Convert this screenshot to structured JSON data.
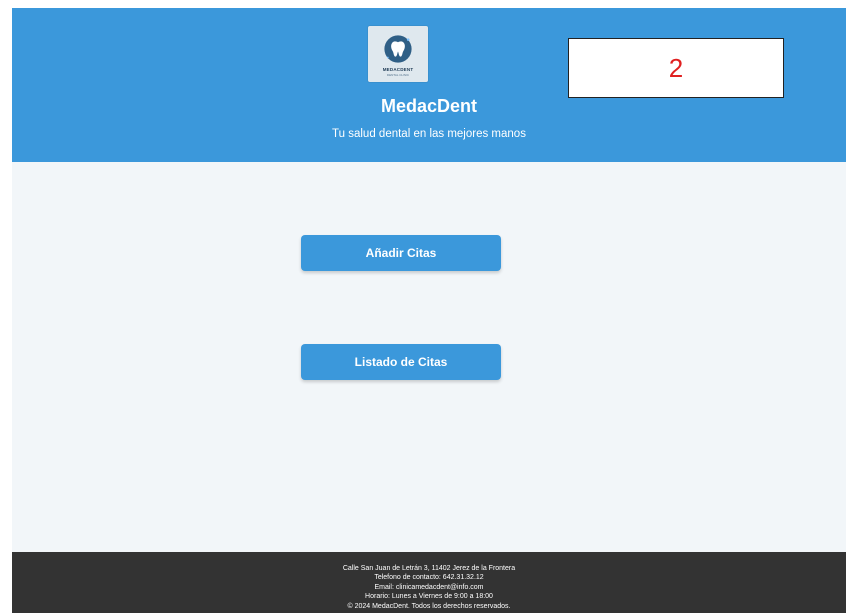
{
  "header": {
    "logo": {
      "icon": "tooth-icon",
      "text": "MEDACDENT",
      "subtext": "DENTAL CLINIC"
    },
    "title": "MedacDent",
    "tagline": "Tu salud dental en las mejores manos",
    "counter_box": "2"
  },
  "main": {
    "add_button_label": "Añadir Citas",
    "list_button_label": "Listado de Citas"
  },
  "footer": {
    "address": "Calle San Juan de Letrán 3, 11402 Jerez de la Frontera",
    "phone": "Telefono de contacto: 642.31.32.12",
    "email": "Email: clinicamedacdent@info.com",
    "hours": "Horario: Lunes a Viernes de 9:00 a 18:00",
    "copyright": "© 2024 MedacDent. Todos los derechos reservados."
  },
  "colors": {
    "primary": "#3b98db",
    "footer_bg": "#333333",
    "page_bg": "#f2f6f9",
    "counter_text": "#e02020"
  }
}
